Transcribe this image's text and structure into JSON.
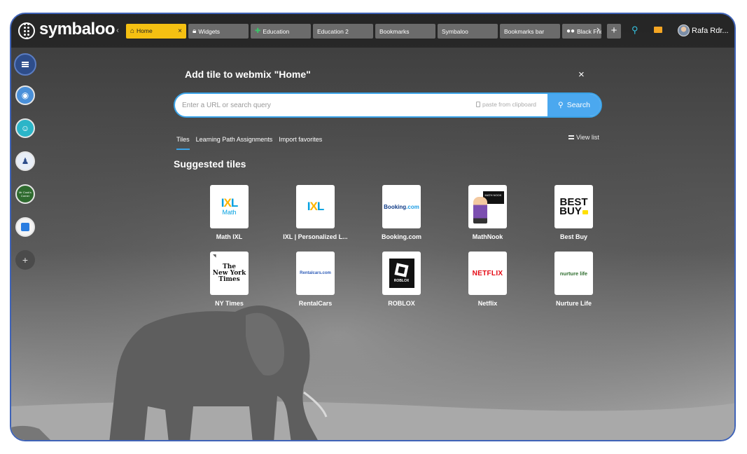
{
  "app": {
    "logo_text": "symbaloo",
    "user_name": "Rafa Rdr..."
  },
  "tabs": [
    {
      "label": "Home",
      "active": true,
      "icon": "home-icon",
      "close": "×"
    },
    {
      "label": "Widgets",
      "active": false,
      "icon": "lock-icon"
    },
    {
      "label": "Education",
      "active": false,
      "icon": "puzzle-icon"
    },
    {
      "label": "Education 2",
      "active": false
    },
    {
      "label": "Bookmarks",
      "active": false
    },
    {
      "label": "Symbaloo",
      "active": false
    },
    {
      "label": "Bookmarks bar",
      "active": false
    },
    {
      "label": "Black Frid",
      "active": false,
      "icon": "glasses-icon"
    }
  ],
  "dialog": {
    "title": "Add tile to webmix \"Home\"",
    "close": "×",
    "search": {
      "placeholder": "Enter a URL or search query",
      "value": "",
      "paste_label": "paste from clipboard",
      "button_label": "Search"
    },
    "subtabs": [
      {
        "label": "Tiles",
        "active": true
      },
      {
        "label": "Learning Path Assignments",
        "active": false
      },
      {
        "label": "Import favorites",
        "active": false
      }
    ],
    "view_list_label": "View list",
    "section_title": "Suggested tiles",
    "tiles": [
      {
        "name": "Math IXL",
        "logo": "IXL",
        "sub": "Math"
      },
      {
        "name": "IXL | Personalized L...",
        "logo": "IXL"
      },
      {
        "name": "Booking.com",
        "logo": "Booking.com"
      },
      {
        "name": "MathNook",
        "logo": "MATH NOOK"
      },
      {
        "name": "Best Buy",
        "logo": "BEST BUY"
      },
      {
        "name": "NY Times",
        "logo": "The New York Times"
      },
      {
        "name": "RentalCars",
        "logo": "Rentalcars.com"
      },
      {
        "name": "ROBLOX",
        "logo": "ROBLOX"
      },
      {
        "name": "Netflix",
        "logo": "NETFLIX"
      },
      {
        "name": "Nurture Life",
        "logo": "nurture life"
      }
    ]
  },
  "sidebar": {
    "corner_label": "Mr Cook's Corner"
  },
  "colors": {
    "accent": "#4ba8ef",
    "active_tab": "#f5c012",
    "frame_border": "#3f63b8"
  }
}
